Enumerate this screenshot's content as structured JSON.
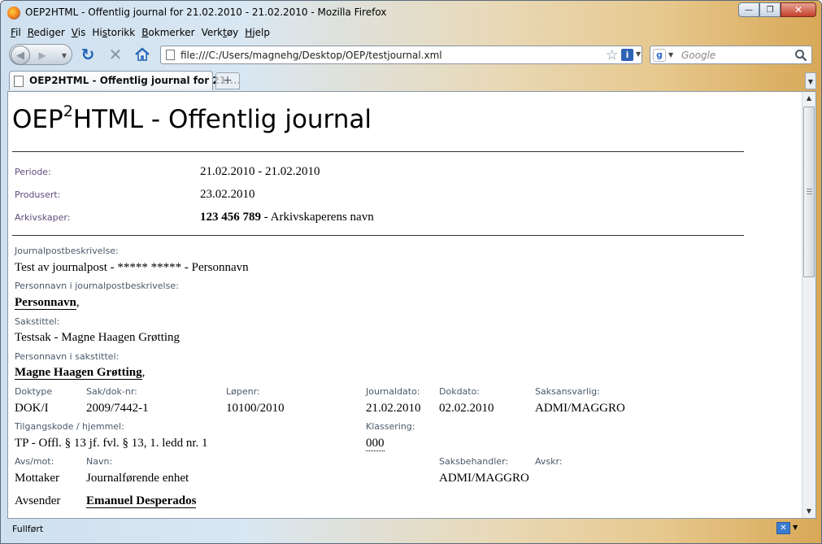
{
  "window": {
    "title": "OEP2HTML - Offentlig journal for 21.02.2010 - 21.02.2010 - Mozilla Firefox",
    "minimize": "—",
    "restore": "❐",
    "close": "✕"
  },
  "menu": {
    "items": [
      {
        "label": "Fil",
        "accel": "F"
      },
      {
        "label": "Rediger",
        "accel": "R"
      },
      {
        "label": "Vis",
        "accel": "V"
      },
      {
        "label": "Historikk",
        "accel": "s"
      },
      {
        "label": "Bokmerker",
        "accel": "B"
      },
      {
        "label": "Verktøy",
        "accel": "t"
      },
      {
        "label": "Hjelp",
        "accel": "H"
      }
    ]
  },
  "toolbar": {
    "url": "file:///C:/Users/magnehg/Desktop/OEP/testjournal.xml",
    "search_placeholder": "Google"
  },
  "tabs": [
    {
      "label": "OEP2HTML - Offentlig journal for 21...."
    }
  ],
  "doc": {
    "title_prefix": "OEP",
    "title_sup": "2",
    "title_suffix": "HTML - Offentlig journal",
    "periode_label": "Periode:",
    "periode": "21.02.2010 - 21.02.2010",
    "produsert_label": "Produsert:",
    "produsert": "23.02.2010",
    "arkivskaper_label": "Arkivskaper:",
    "arkivskaper_nr": "123 456 789",
    "arkivskaper_navn": " - Arkivskaperens navn",
    "jp_beskrivelse_label": "Journalpostbeskrivelse:",
    "jp_beskrivelse": "Test av journalpost - ***** ***** - Personnavn",
    "jp_personnavn_label": "Personnavn i journalpostbeskrivelse:",
    "jp_personnavn": "Personnavn",
    "sakstittel_label": "Sakstittel:",
    "sakstittel": "Testsak - Magne Haagen Grøtting",
    "sak_personnavn_label": "Personnavn i sakstittel:",
    "sak_personnavn": "Magne Haagen Grøtting",
    "comma": ",",
    "doktype_label": "Doktype",
    "doktype": "DOK/I",
    "sakdok_label": "Sak/dok-nr:",
    "sakdok": "2009/7442-1",
    "lopenr_label": "Løpenr:",
    "lopenr": "10100/2010",
    "journaldato_label": "Journaldato:",
    "journaldato": "21.02.2010",
    "dokdato_label": "Dokdato:",
    "dokdato": "02.02.2010",
    "saksansvarlig_label": "Saksansvarlig:",
    "saksansvarlig": "ADMI/MAGGRO",
    "tilgangskode_label": "Tilgangskode / hjemmel:",
    "tilgangskode": "TP - Offl. § 13 jf. fvl. § 13, 1. ledd nr. 1",
    "klassering_label": "Klassering:",
    "klassering": "000",
    "avsmot_label": "Avs/mot:",
    "navn_label": "Navn:",
    "saksbehandler_label": "Saksbehandler:",
    "avskr_label": "Avskr:",
    "mottaker_label": "Mottaker",
    "mottaker_navn": "Journalførende enhet",
    "saksbehandler": "ADMI/MAGGRO",
    "avsender_label": "Avsender",
    "avsender_navn": "Emanuel Desperados"
  },
  "status": {
    "text": "Fullført"
  }
}
